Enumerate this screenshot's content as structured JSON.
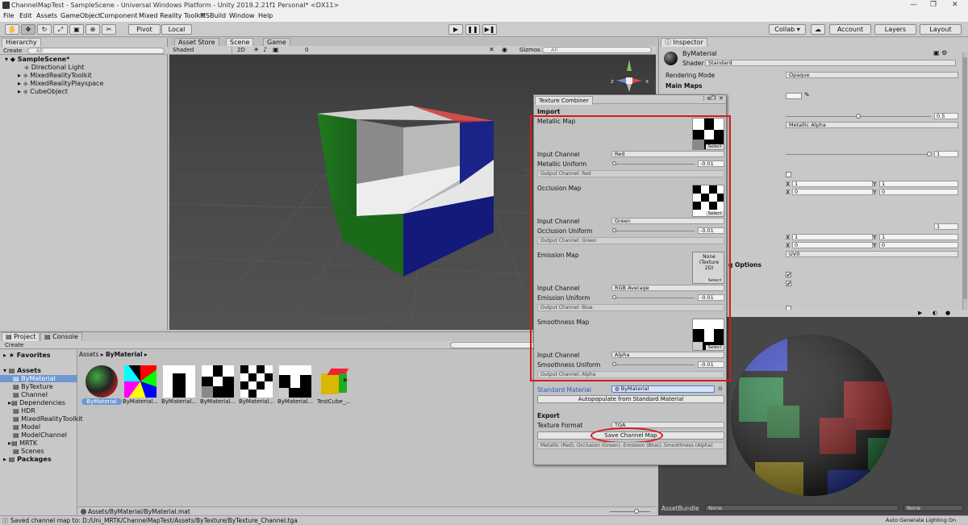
{
  "window": {
    "title": "ChannelMapTest - SampleScene - Universal Windows Platform - Unity 2019.2.21f1 Personal* <DX11>",
    "controls": [
      "—",
      "❐",
      "✕"
    ]
  },
  "menu": [
    "File",
    "Edit",
    "Assets",
    "GameObject",
    "Component",
    "Mixed Reality Toolkit",
    "MSBuild",
    "Window",
    "Help"
  ],
  "toolbar": {
    "pivot": "Pivot",
    "local": "Local",
    "collab": "Collab ▾",
    "account": "Account",
    "layers": "Layers",
    "layout": "Layout"
  },
  "hierarchy": {
    "tab": "Hierarchy",
    "create": "Create",
    "search_placeholder": "All",
    "scene": "SampleScene*",
    "items": [
      "Directional Light",
      "MixedRealityToolkit",
      "MixedRealityPlayspace",
      "CubeObject"
    ]
  },
  "scene_tabs": [
    "Asset Store",
    "Scene",
    "Game"
  ],
  "scene_bar": {
    "shading": "Shaded",
    "mode2d": "2D",
    "gizmos": "Gizmos",
    "search_placeholder": "All",
    "count": "0"
  },
  "gizmo": {
    "x": "x",
    "z": "z"
  },
  "inspector": {
    "tab": "Inspector",
    "material_name": "ByMaterial",
    "shader_label": "Shader",
    "shader_value": "Standard",
    "rendering_mode_label": "Rendering Mode",
    "rendering_mode_value": "Opaque",
    "main_maps": "Main Maps",
    "smoothness_value": "0.5",
    "source_value": "Metallic Alpha",
    "normal_value": "1",
    "tiling_x1": "1",
    "tiling_y1": "1",
    "offset_x1": "0",
    "offset_y1": "0",
    "detail_value": "1",
    "tiling_x2": "1",
    "tiling_y2": "1",
    "offset_x2": "0",
    "offset_y2": "0",
    "uv_value": "UV0",
    "options_label": "g Options",
    "axis_x": "X",
    "axis_y": "Y"
  },
  "texture_combiner": {
    "title": "Texture Combiner",
    "import": "Import",
    "metallic_map": "Metallic Map",
    "occlusion_map": "Occlusion Map",
    "emission_map": "Emission Map",
    "smoothness_map": "Smoothness Map",
    "input_channel": "Input Channel",
    "metallic_channel": "Red",
    "occlusion_channel": "Green",
    "emission_channel": "RGB Average",
    "smoothness_channel": "Alpha",
    "metallic_uniform": "Metallic Uniform",
    "occlusion_uniform": "Occlusion Uniform",
    "emission_uniform": "Emission Uniform",
    "smoothness_uniform": "Smoothness Uniform",
    "uniform_value": "-0.01",
    "out_red": "Output Channel: Red",
    "out_green": "Output Channel: Green",
    "out_blue": "Output Channel: Blue",
    "out_alpha": "Output Channel: Alpha",
    "select": "Select",
    "none_texture": "None (Texture 2D)",
    "standard_material_label": "Standard Material",
    "standard_material_value": "ByMaterial",
    "autopopulate": "Autopopulate from Standard Material",
    "export": "Export",
    "texture_format_label": "Texture Format",
    "texture_format_value": "TGA",
    "save": "Save Channel Map",
    "summary": "Metallic (Red), Occlusion (Green), Emission (Blue), Smoothness (Alpha)"
  },
  "project": {
    "tab": "Project",
    "console_tab": "Console",
    "create": "Create",
    "breadcrumb_root": "Assets",
    "breadcrumb_leaf": "ByMaterial",
    "favorites": "Favorites",
    "assets": "Assets",
    "packages": "Packages",
    "folders": [
      "ByMaterial",
      "ByTexture",
      "Channel",
      "Dependencies",
      "HDR",
      "MixedRealityToolkit",
      "Model",
      "ModelChannel",
      "MRTK",
      "Scenes"
    ],
    "items": [
      "ByMaterial",
      "ByMaterial...",
      "ByMaterial...",
      "ByMaterial...",
      "ByMaterial...",
      "ByMaterial...",
      "TestCube_..."
    ],
    "path": "Assets/ByMaterial/ByMaterial.mat"
  },
  "preview": {
    "assetbundle_label": "AssetBundle",
    "assetbundle_value": "None",
    "variant_value": "None"
  },
  "status": {
    "message": "Saved channel map to: D:/Uni_MRTK/ChannelMapTest/Assets/ByTexture/ByTexture_Channel.tga",
    "lighting": "Auto Generate Lighting On"
  }
}
